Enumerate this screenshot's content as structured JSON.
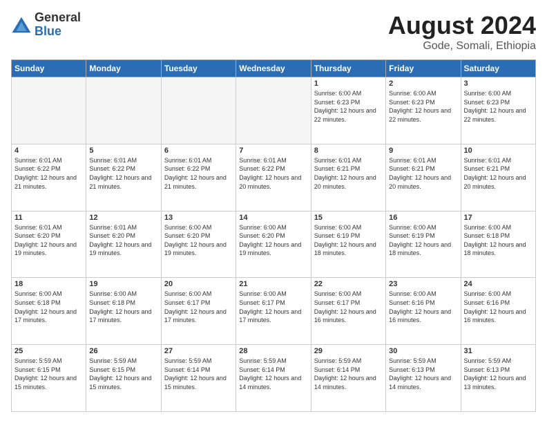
{
  "logo": {
    "general": "General",
    "blue": "Blue"
  },
  "title": "August 2024",
  "location": "Gode, Somali, Ethiopia",
  "days_header": [
    "Sunday",
    "Monday",
    "Tuesday",
    "Wednesday",
    "Thursday",
    "Friday",
    "Saturday"
  ],
  "weeks": [
    [
      {
        "day": "",
        "sunrise": "",
        "sunset": "",
        "daylight": "",
        "empty": true
      },
      {
        "day": "",
        "sunrise": "",
        "sunset": "",
        "daylight": "",
        "empty": true
      },
      {
        "day": "",
        "sunrise": "",
        "sunset": "",
        "daylight": "",
        "empty": true
      },
      {
        "day": "",
        "sunrise": "",
        "sunset": "",
        "daylight": "",
        "empty": true
      },
      {
        "day": "1",
        "sunrise": "Sunrise: 6:00 AM",
        "sunset": "Sunset: 6:23 PM",
        "daylight": "Daylight: 12 hours and 22 minutes.",
        "empty": false
      },
      {
        "day": "2",
        "sunrise": "Sunrise: 6:00 AM",
        "sunset": "Sunset: 6:23 PM",
        "daylight": "Daylight: 12 hours and 22 minutes.",
        "empty": false
      },
      {
        "day": "3",
        "sunrise": "Sunrise: 6:00 AM",
        "sunset": "Sunset: 6:23 PM",
        "daylight": "Daylight: 12 hours and 22 minutes.",
        "empty": false
      }
    ],
    [
      {
        "day": "4",
        "sunrise": "Sunrise: 6:01 AM",
        "sunset": "Sunset: 6:22 PM",
        "daylight": "Daylight: 12 hours and 21 minutes.",
        "empty": false
      },
      {
        "day": "5",
        "sunrise": "Sunrise: 6:01 AM",
        "sunset": "Sunset: 6:22 PM",
        "daylight": "Daylight: 12 hours and 21 minutes.",
        "empty": false
      },
      {
        "day": "6",
        "sunrise": "Sunrise: 6:01 AM",
        "sunset": "Sunset: 6:22 PM",
        "daylight": "Daylight: 12 hours and 21 minutes.",
        "empty": false
      },
      {
        "day": "7",
        "sunrise": "Sunrise: 6:01 AM",
        "sunset": "Sunset: 6:22 PM",
        "daylight": "Daylight: 12 hours and 20 minutes.",
        "empty": false
      },
      {
        "day": "8",
        "sunrise": "Sunrise: 6:01 AM",
        "sunset": "Sunset: 6:21 PM",
        "daylight": "Daylight: 12 hours and 20 minutes.",
        "empty": false
      },
      {
        "day": "9",
        "sunrise": "Sunrise: 6:01 AM",
        "sunset": "Sunset: 6:21 PM",
        "daylight": "Daylight: 12 hours and 20 minutes.",
        "empty": false
      },
      {
        "day": "10",
        "sunrise": "Sunrise: 6:01 AM",
        "sunset": "Sunset: 6:21 PM",
        "daylight": "Daylight: 12 hours and 20 minutes.",
        "empty": false
      }
    ],
    [
      {
        "day": "11",
        "sunrise": "Sunrise: 6:01 AM",
        "sunset": "Sunset: 6:20 PM",
        "daylight": "Daylight: 12 hours and 19 minutes.",
        "empty": false
      },
      {
        "day": "12",
        "sunrise": "Sunrise: 6:01 AM",
        "sunset": "Sunset: 6:20 PM",
        "daylight": "Daylight: 12 hours and 19 minutes.",
        "empty": false
      },
      {
        "day": "13",
        "sunrise": "Sunrise: 6:00 AM",
        "sunset": "Sunset: 6:20 PM",
        "daylight": "Daylight: 12 hours and 19 minutes.",
        "empty": false
      },
      {
        "day": "14",
        "sunrise": "Sunrise: 6:00 AM",
        "sunset": "Sunset: 6:20 PM",
        "daylight": "Daylight: 12 hours and 19 minutes.",
        "empty": false
      },
      {
        "day": "15",
        "sunrise": "Sunrise: 6:00 AM",
        "sunset": "Sunset: 6:19 PM",
        "daylight": "Daylight: 12 hours and 18 minutes.",
        "empty": false
      },
      {
        "day": "16",
        "sunrise": "Sunrise: 6:00 AM",
        "sunset": "Sunset: 6:19 PM",
        "daylight": "Daylight: 12 hours and 18 minutes.",
        "empty": false
      },
      {
        "day": "17",
        "sunrise": "Sunrise: 6:00 AM",
        "sunset": "Sunset: 6:18 PM",
        "daylight": "Daylight: 12 hours and 18 minutes.",
        "empty": false
      }
    ],
    [
      {
        "day": "18",
        "sunrise": "Sunrise: 6:00 AM",
        "sunset": "Sunset: 6:18 PM",
        "daylight": "Daylight: 12 hours and 17 minutes.",
        "empty": false
      },
      {
        "day": "19",
        "sunrise": "Sunrise: 6:00 AM",
        "sunset": "Sunset: 6:18 PM",
        "daylight": "Daylight: 12 hours and 17 minutes.",
        "empty": false
      },
      {
        "day": "20",
        "sunrise": "Sunrise: 6:00 AM",
        "sunset": "Sunset: 6:17 PM",
        "daylight": "Daylight: 12 hours and 17 minutes.",
        "empty": false
      },
      {
        "day": "21",
        "sunrise": "Sunrise: 6:00 AM",
        "sunset": "Sunset: 6:17 PM",
        "daylight": "Daylight: 12 hours and 17 minutes.",
        "empty": false
      },
      {
        "day": "22",
        "sunrise": "Sunrise: 6:00 AM",
        "sunset": "Sunset: 6:17 PM",
        "daylight": "Daylight: 12 hours and 16 minutes.",
        "empty": false
      },
      {
        "day": "23",
        "sunrise": "Sunrise: 6:00 AM",
        "sunset": "Sunset: 6:16 PM",
        "daylight": "Daylight: 12 hours and 16 minutes.",
        "empty": false
      },
      {
        "day": "24",
        "sunrise": "Sunrise: 6:00 AM",
        "sunset": "Sunset: 6:16 PM",
        "daylight": "Daylight: 12 hours and 16 minutes.",
        "empty": false
      }
    ],
    [
      {
        "day": "25",
        "sunrise": "Sunrise: 5:59 AM",
        "sunset": "Sunset: 6:15 PM",
        "daylight": "Daylight: 12 hours and 15 minutes.",
        "empty": false
      },
      {
        "day": "26",
        "sunrise": "Sunrise: 5:59 AM",
        "sunset": "Sunset: 6:15 PM",
        "daylight": "Daylight: 12 hours and 15 minutes.",
        "empty": false
      },
      {
        "day": "27",
        "sunrise": "Sunrise: 5:59 AM",
        "sunset": "Sunset: 6:14 PM",
        "daylight": "Daylight: 12 hours and 15 minutes.",
        "empty": false
      },
      {
        "day": "28",
        "sunrise": "Sunrise: 5:59 AM",
        "sunset": "Sunset: 6:14 PM",
        "daylight": "Daylight: 12 hours and 14 minutes.",
        "empty": false
      },
      {
        "day": "29",
        "sunrise": "Sunrise: 5:59 AM",
        "sunset": "Sunset: 6:14 PM",
        "daylight": "Daylight: 12 hours and 14 minutes.",
        "empty": false
      },
      {
        "day": "30",
        "sunrise": "Sunrise: 5:59 AM",
        "sunset": "Sunset: 6:13 PM",
        "daylight": "Daylight: 12 hours and 14 minutes.",
        "empty": false
      },
      {
        "day": "31",
        "sunrise": "Sunrise: 5:59 AM",
        "sunset": "Sunset: 6:13 PM",
        "daylight": "Daylight: 12 hours and 13 minutes.",
        "empty": false
      }
    ]
  ]
}
